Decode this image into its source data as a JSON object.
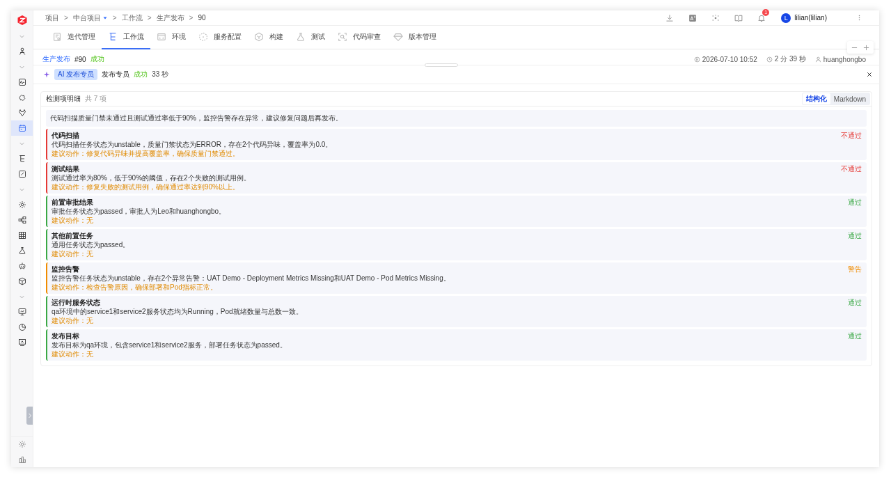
{
  "sidebar": {
    "items": [
      {
        "kind": "chevron"
      },
      {
        "kind": "nav",
        "selected": false
      },
      {
        "kind": "chevron"
      },
      {
        "kind": "nav",
        "selected": false
      },
      {
        "kind": "nav",
        "selected": false
      },
      {
        "kind": "nav",
        "selected": false
      },
      {
        "kind": "nav",
        "selected": true
      },
      {
        "kind": "chevron"
      },
      {
        "kind": "nav",
        "selected": false
      },
      {
        "kind": "nav",
        "selected": false
      },
      {
        "kind": "chevron"
      },
      {
        "kind": "nav",
        "selected": false
      },
      {
        "kind": "nav",
        "selected": false
      },
      {
        "kind": "nav",
        "selected": false
      },
      {
        "kind": "nav",
        "selected": false
      },
      {
        "kind": "nav",
        "selected": false
      },
      {
        "kind": "nav",
        "selected": false
      },
      {
        "kind": "chevron"
      },
      {
        "kind": "nav",
        "selected": false
      },
      {
        "kind": "nav",
        "selected": false
      },
      {
        "kind": "nav",
        "selected": false
      }
    ],
    "bottom": [
      {
        "kind": "nav"
      },
      {
        "kind": "nav"
      }
    ]
  },
  "breadcrumb": [
    {
      "kind": "link",
      "label": "项目",
      "dropdown": false
    },
    {
      "kind": "sep",
      "label": ">"
    },
    {
      "kind": "link",
      "label": "中台项目",
      "dropdown": true
    },
    {
      "kind": "sep",
      "label": ">"
    },
    {
      "kind": "link",
      "label": "工作流",
      "dropdown": false
    },
    {
      "kind": "sep",
      "label": ">"
    },
    {
      "kind": "link",
      "label": "生产发布",
      "dropdown": false
    },
    {
      "kind": "sep",
      "label": ">"
    },
    {
      "kind": "current",
      "label": "90"
    }
  ],
  "header": {
    "notification_count": "1",
    "user": {
      "initial": "L",
      "name": "lilian(lilian)"
    }
  },
  "tabs": [
    {
      "label": "迭代管理",
      "selected": false
    },
    {
      "label": "工作流",
      "selected": true
    },
    {
      "label": "环境",
      "selected": false
    },
    {
      "label": "服务配置",
      "selected": false
    },
    {
      "label": "构建",
      "selected": false
    },
    {
      "label": "测试",
      "selected": false
    },
    {
      "label": "代码审查",
      "selected": false
    },
    {
      "label": "版本管理",
      "selected": false
    }
  ],
  "run": {
    "workflow": "生产发布",
    "number": "#90",
    "status": "成功",
    "started": "2026-07-10 10:52",
    "duration": "2 分 39 秒",
    "user": "huanghongbo"
  },
  "agent": {
    "tag": "AI 发布专员",
    "name": "发布专员",
    "status": "成功",
    "duration": "33 秒"
  },
  "report": {
    "title": "检测项明细",
    "count": "共 7 项",
    "views": [
      {
        "label": "结构化",
        "selected": true
      },
      {
        "label": "Markdown",
        "selected": false
      }
    ],
    "summary": "代码扫描质量门禁未通过且测试通过率低于90%，监控告警存在异常，建议修复问题后再发布。",
    "items": [
      {
        "title": "代码扫描",
        "description": "代码扫描任务状态为unstable，质量门禁状态为ERROR，存在2个代码异味，覆盖率为0.0。",
        "advice": "建议动作：修复代码异味并提高覆盖率，确保质量门禁通过。",
        "status": "不通过",
        "kind": "fail"
      },
      {
        "title": "测试结果",
        "description": "测试通过率为80%，低于90%的阈值，存在2个失败的测试用例。",
        "advice": "建议动作：修复失败的测试用例，确保通过率达到90%以上。",
        "status": "不通过",
        "kind": "fail"
      },
      {
        "title": "前置审批结果",
        "description": "审批任务状态为passed，审批人为Leo和huanghongbo。",
        "advice": "建议动作：无",
        "status": "通过",
        "kind": "pass"
      },
      {
        "title": "其他前置任务",
        "description": "通用任务状态为passed。",
        "advice": "建议动作：无",
        "status": "通过",
        "kind": "pass"
      },
      {
        "title": "监控告警",
        "description": "监控告警任务状态为unstable，存在2个异常告警：UAT Demo - Deployment Metrics Missing和UAT Demo - Pod Metrics Missing。",
        "advice": "建议动作：检查告警原因，确保部署和Pod指标正常。",
        "status": "警告",
        "kind": "warn"
      },
      {
        "title": "运行时服务状态",
        "description": "qa环境中的service1和service2服务状态均为Running，Pod就绪数量与总数一致。",
        "advice": "建议动作：无",
        "status": "通过",
        "kind": "pass"
      },
      {
        "title": "发布目标",
        "description": "发布目标为qa环境，包含service1和service2服务，部署任务状态为passed。",
        "advice": "建议动作：无",
        "status": "通过",
        "kind": "pass"
      }
    ]
  }
}
